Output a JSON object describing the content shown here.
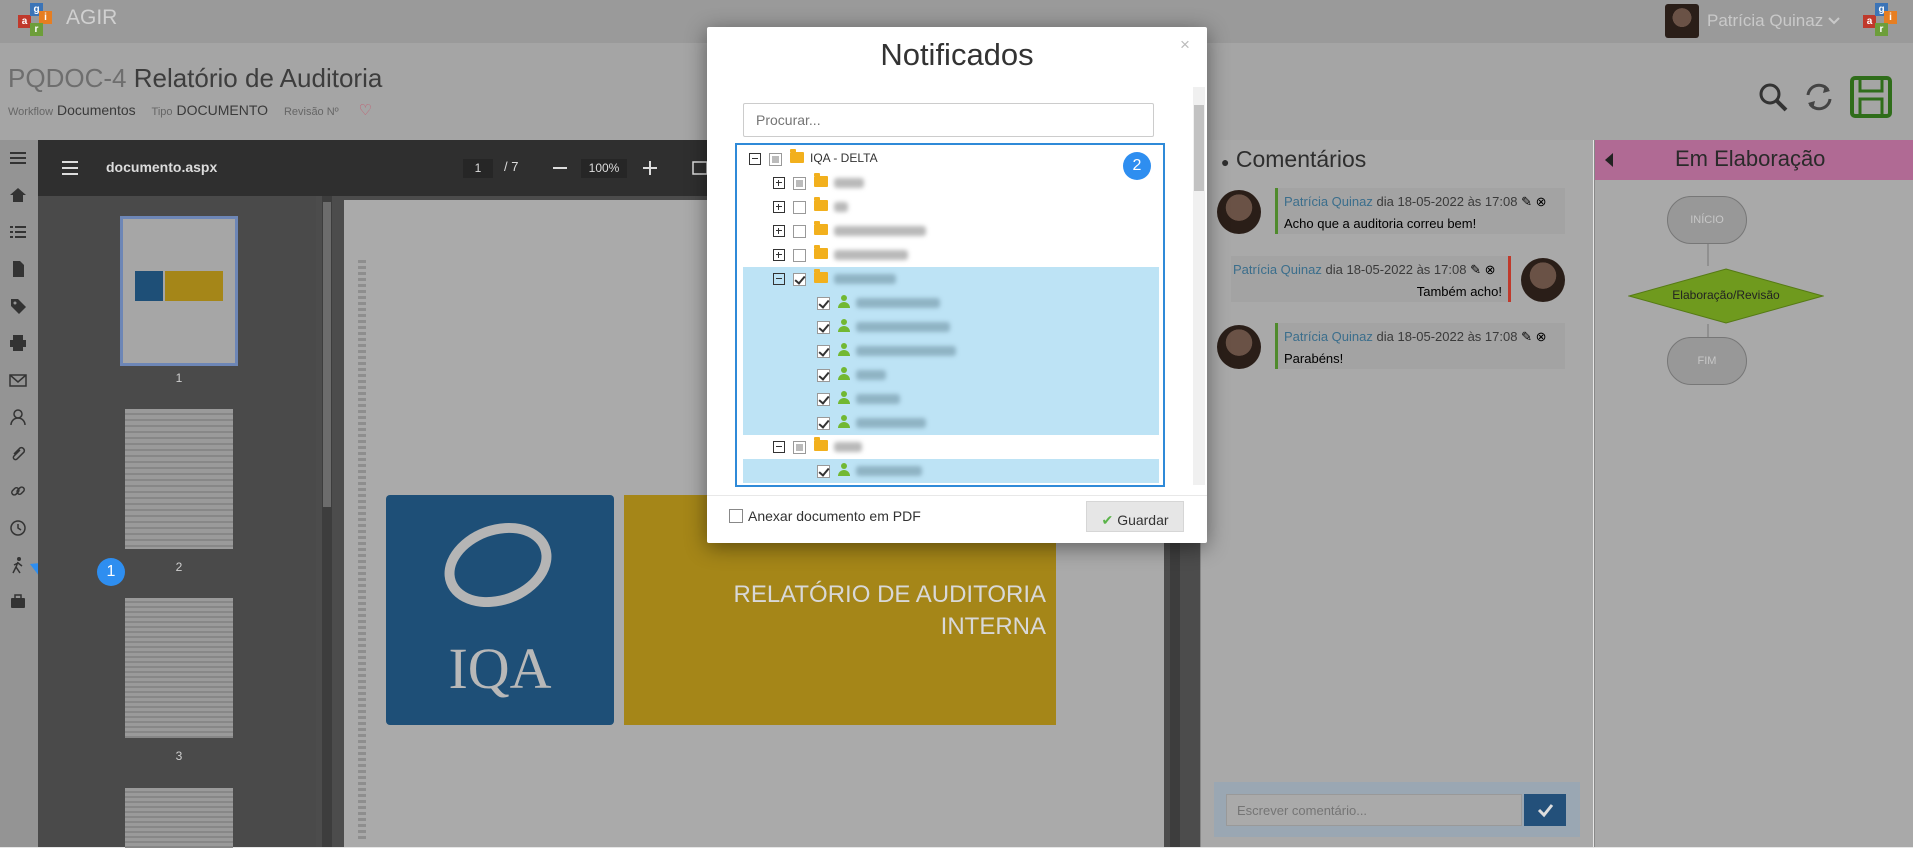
{
  "app": {
    "name": "AGIR",
    "logo_letters": [
      "a",
      "g",
      "i",
      "r"
    ]
  },
  "user": {
    "name": "Patrícia Quinaz"
  },
  "document": {
    "code": "PQDOC-4",
    "title": "Relatório de Auditoria",
    "workflow_label": "Workflow",
    "workflow_value": "Documentos",
    "type_label": "Tipo",
    "type_value": "DOCUMENTO",
    "revision_label": "Revisão Nº"
  },
  "viewer": {
    "filename": "documento.aspx",
    "current_page": "1",
    "total_pages": "/  7",
    "zoom": "100%",
    "thumbnails": [
      "1",
      "2",
      "3"
    ],
    "cover_logo": "IQA",
    "cover_title_line1": "RELATÓRIO DE AUDITORIA",
    "cover_title_line2": "INTERNA"
  },
  "comments": {
    "title": "Comentários",
    "items": [
      {
        "author": "Patrícia Quinaz",
        "date": "dia 18-05-2022 às 17:08",
        "text": "Acho que a auditoria correu bem!"
      },
      {
        "author": "Patrícia Quinaz",
        "date": "dia 18-05-2022 às 17:08",
        "text": "Também acho!"
      },
      {
        "author": "Patrícia Quinaz",
        "date": "dia 18-05-2022 às 17:08",
        "text": "Parabéns!"
      }
    ],
    "input_placeholder": "Escrever comentário..."
  },
  "workflow": {
    "title": "Em Elaboração",
    "nodes": [
      "INÍCIO",
      "Elaboração/Revisão",
      "FIM"
    ]
  },
  "modal": {
    "title": "Notificados",
    "close": "×",
    "search_placeholder": "Procurar...",
    "root_label": "IQA - DELTA",
    "attach_label": "Anexar documento em PDF",
    "save_label": "Guardar"
  },
  "steps": {
    "one": "1",
    "two": "2"
  },
  "colors": {
    "accent": "#2e8ef0",
    "workflow_header": "#b06a94",
    "person_icon": "#72b832",
    "folder": "#f2b01d"
  }
}
